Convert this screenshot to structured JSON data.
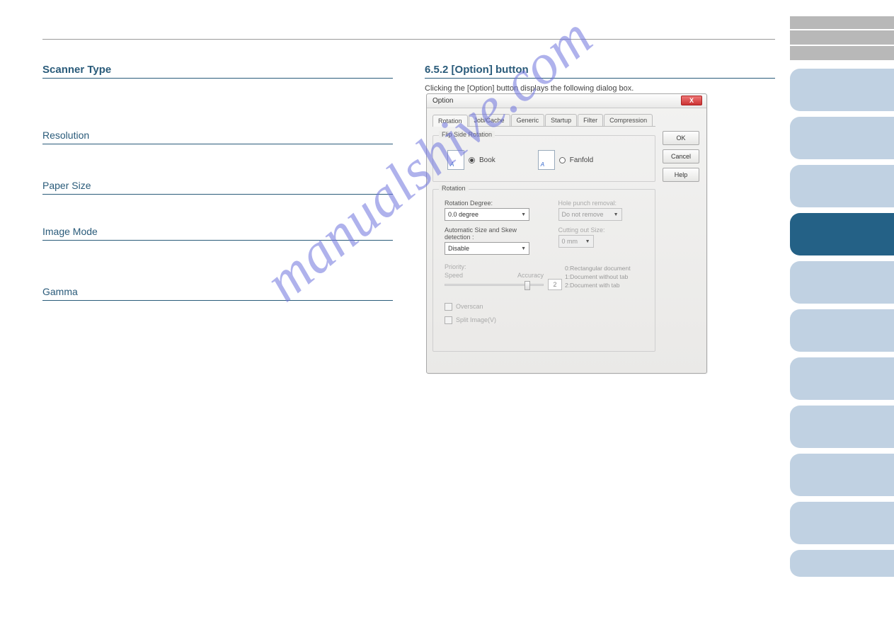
{
  "left": {
    "sections": [
      {
        "title": "Scanner Type"
      },
      {
        "title": "Resolution"
      },
      {
        "title": "Paper Size"
      },
      {
        "title": "Image Mode"
      },
      {
        "title": "Gamma"
      }
    ]
  },
  "right": {
    "title": "6.5.2 [Option] button",
    "intro": "Clicking the [Option] button displays the following dialog box.",
    "tabs": [
      "Rotation",
      "Job/Cache",
      "Generic",
      "Startup",
      "Filter",
      "Compression"
    ],
    "dialog": {
      "window_title": "Option",
      "buttons": {
        "ok": "OK",
        "cancel": "Cancel",
        "help": "Help"
      },
      "flip_group": "Flip Side Rotation",
      "radio_book": "Book",
      "radio_fanfold": "Fanfold",
      "rotation_group": "Rotation",
      "rotation_degree_label": "Rotation Degree:",
      "rotation_degree_value": "0.0 degree",
      "hole_punch_label": "Hole punch removal:",
      "hole_punch_value": "Do not remove",
      "auto_size_label": "Automatic Size and Skew detection :",
      "auto_size_value": "Disable",
      "cutting_label": "Cutting out Size:",
      "cutting_value": "0 mm",
      "priority_label": "Priority:",
      "priority_speed": "Speed",
      "priority_accuracy": "Accuracy",
      "priority_val": "2",
      "priority_notes": [
        "0:Rectangular document",
        "1:Document without tab",
        "2:Document with tab"
      ],
      "overscan": "Overscan",
      "split_image": "Split Image(V)"
    }
  },
  "watermark": "manualshive.com"
}
